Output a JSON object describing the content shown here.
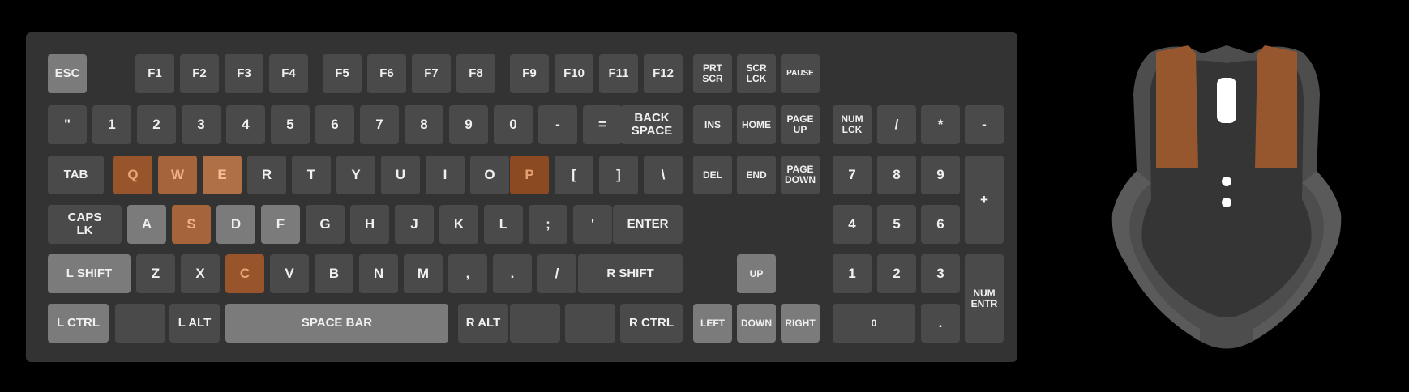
{
  "colors": {
    "background": "#000000",
    "keyboard_body": "#333333",
    "key_default": "#4a4a4a",
    "key_light": "#7b7b7b",
    "key_highlight": "#98552b",
    "mouse_shell": "#4d4d4d",
    "mouse_buttons_highlight": "#96572f"
  },
  "keyboard": {
    "function_row": {
      "esc": "ESC",
      "f1": "F1",
      "f2": "F2",
      "f3": "F3",
      "f4": "F4",
      "f5": "F5",
      "f6": "F6",
      "f7": "F7",
      "f8": "F8",
      "f9": "F9",
      "f10": "F10",
      "f11": "F11",
      "f12": "F12",
      "prtscr": "PRT\nSCR",
      "scrlck": "SCR\nLCK",
      "pause": "PAUSE"
    },
    "number_row": {
      "backtick": "\"",
      "n1": "1",
      "n2": "2",
      "n3": "3",
      "n4": "4",
      "n5": "5",
      "n6": "6",
      "n7": "7",
      "n8": "8",
      "n9": "9",
      "n0": "0",
      "minus": "-",
      "equals": "=",
      "backspace": "BACK\nSPACE",
      "ins": "INS",
      "home": "HOME",
      "pageup": "PAGE\nUP"
    },
    "tab_row": {
      "tab": "TAB",
      "q": "Q",
      "w": "W",
      "e": "E",
      "r": "R",
      "t": "T",
      "y": "Y",
      "u": "U",
      "i": "I",
      "o": "O",
      "p": "P",
      "lbracket": "[",
      "rbracket": "]",
      "backslash": "\\",
      "del": "DEL",
      "end": "END",
      "pagedown": "PAGE\nDOWN"
    },
    "caps_row": {
      "caps": "CAPS\nLK",
      "a": "A",
      "s": "S",
      "d": "D",
      "f": "F",
      "g": "G",
      "h": "H",
      "j": "J",
      "k": "K",
      "l": "L",
      "semicolon": ";",
      "quote": "'",
      "enter": "ENTER"
    },
    "shift_row": {
      "lshift": "L SHIFT",
      "z": "Z",
      "x": "X",
      "c": "C",
      "v": "V",
      "b": "B",
      "n": "N",
      "m": "M",
      "comma": ",",
      "period": ".",
      "slash": "/",
      "rshift": "R SHIFT",
      "up": "UP"
    },
    "bottom_row": {
      "lctrl": "L CTRL",
      "lwin": "",
      "lalt": "L ALT",
      "space": "SPACE BAR",
      "ralt": "R ALT",
      "rwin": "",
      "menu": "",
      "rctrl": "R CTRL",
      "left": "LEFT",
      "down": "DOWN",
      "right": "RIGHT"
    },
    "numpad": {
      "numlck": "NUM\nLCK",
      "divide": "/",
      "multiply": "*",
      "subtract": "-",
      "n7": "7",
      "n8": "8",
      "n9": "9",
      "add": "+",
      "n4": "4",
      "n5": "5",
      "n6": "6",
      "n1": "1",
      "n2": "2",
      "n3": "3",
      "enter": "NUM\nENTR",
      "n0": "0",
      "decimal": "."
    }
  },
  "mouse": {
    "left_button_highlighted": true,
    "right_button_highlighted": true
  }
}
